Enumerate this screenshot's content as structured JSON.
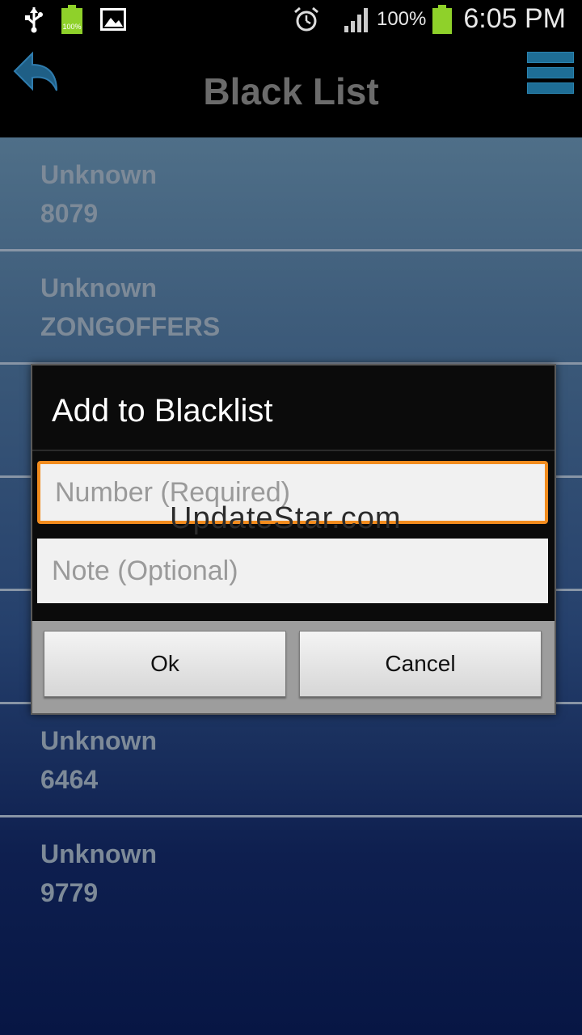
{
  "status_bar": {
    "battery_icon_text": "100%",
    "battery_percent": "100%",
    "time": "6:05 PM"
  },
  "header": {
    "title": "Black List"
  },
  "list": [
    {
      "name": "Unknown",
      "number": "8079"
    },
    {
      "name": "Unknown",
      "number": "ZONGOFFERS"
    },
    {
      "name": "Unknown",
      "number": "6464"
    },
    {
      "name": "Unknown",
      "number": "9779"
    }
  ],
  "dialog": {
    "title": "Add to Blacklist",
    "number_placeholder": "Number (Required)",
    "note_placeholder": "Note (Optional)",
    "ok_label": "Ok",
    "cancel_label": "Cancel"
  },
  "watermark": "UpdateStar.com",
  "colors": {
    "accent_focus": "#f28c1e",
    "menu_icon": "#1e6e96"
  }
}
